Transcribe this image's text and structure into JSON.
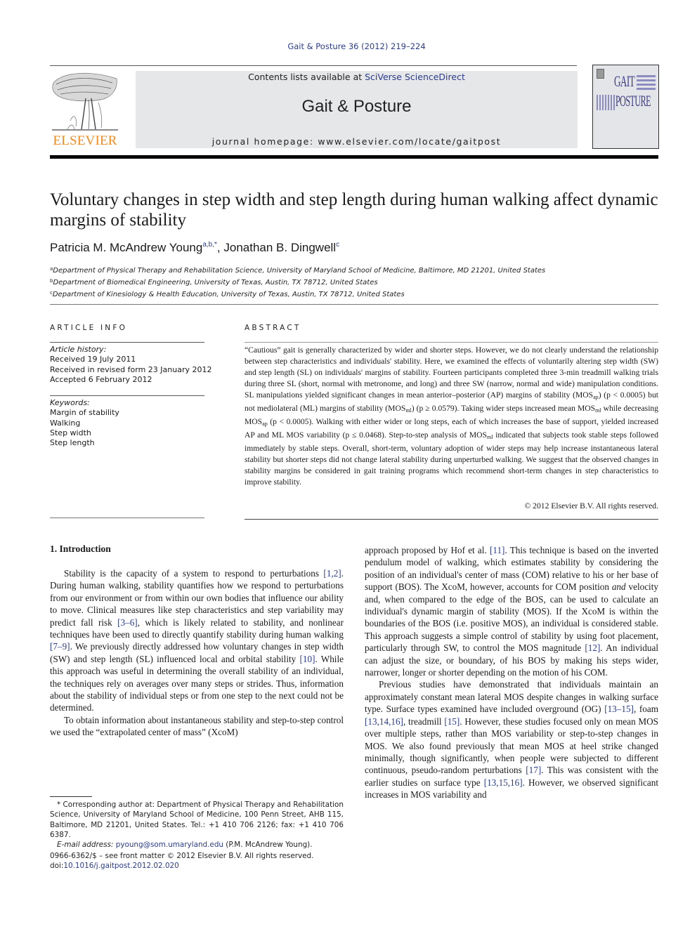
{
  "masthead": {
    "citation": "Gait & Posture 36 (2012) 219–224",
    "contents_prefix": "Contents lists available at ",
    "contents_link": "SciVerse ScienceDirect",
    "journal_title": "Gait & Posture",
    "homepage_prefix": "journal homepage: ",
    "homepage_url": "www.elsevier.com/locate/gaitpost",
    "publisher_logo_text": "ELSEVIER",
    "cover_word_top": "GAIT",
    "cover_word_bottom": "POSTURE",
    "colors": {
      "link": "#2c3c8c",
      "elsevier_orange": "#f08a1c",
      "band_gray": "#e6e7e9"
    }
  },
  "article": {
    "title": "Voluntary changes in step width and step length during human walking affect dynamic margins of stability",
    "authors": [
      {
        "name": "Patricia M. McAndrew Young",
        "sup": "a,b,*"
      },
      {
        "name": "Jonathan B. Dingwell",
        "sup": "c"
      }
    ],
    "author_separator": ", ",
    "affiliations": [
      {
        "key": "a",
        "text": "Department of Physical Therapy and Rehabilitation Science, University of Maryland School of Medicine, Baltimore, MD 21201, United States"
      },
      {
        "key": "b",
        "text": "Department of Biomedical Engineering, University of Texas, Austin, TX 78712, United States"
      },
      {
        "key": "c",
        "text": "Department of Kinesiology & Health Education, University of Texas, Austin, TX 78712, United States"
      }
    ]
  },
  "article_info": {
    "heading": "ARTICLE INFO",
    "history_label": "Article history:",
    "history": [
      "Received 19 July 2011",
      "Received in revised form 23 January 2012",
      "Accepted 6 February 2012"
    ],
    "keywords_label": "Keywords:",
    "keywords": [
      "Margin of stability",
      "Walking",
      "Step width",
      "Step length"
    ]
  },
  "abstract": {
    "heading": "ABSTRACT",
    "parts": {
      "p1": "“Cautious” gait is generally characterized by wider and shorter steps. However, we do not clearly understand the relationship between step characteristics and individuals' stability. Here, we examined the effects of voluntarily altering step width (SW) and step length (SL) on individuals' margins of stability. Fourteen participants completed three 3-min treadmill walking trials during three SL (short, normal with metronome, and long) and three SW (narrow, normal and wide) manipulation conditions. SL manipulations yielded significant changes in mean anterior–posterior (AP) margins of stability (MOS",
      "sub_ap": "ap",
      "p2": ") (p < 0.0005) but not mediolateral (ML) margins of stability (MOS",
      "sub_ml": "ml",
      "p3": ") (p ≥ 0.0579). Taking wider steps increased mean MOS",
      "p4": " while decreasing MOS",
      "p5": " (p < 0.0005). Walking with either wider or long steps, each of which increases the base of support, yielded increased AP and ML MOS variability (p ≤ 0.0468). Step-to-step analysis of MOS",
      "p6": " indicated that subjects took stable steps followed immediately by stable steps. Overall, short-term, voluntary adoption of wider steps may help increase instantaneous lateral stability but shorter steps did not change lateral stability during unperturbed walking. We suggest that the observed changes in stability margins be considered in gait training programs which recommend short-term changes in step characteristics to improve stability."
    },
    "copyright": "© 2012 Elsevier B.V. All rights reserved."
  },
  "body": {
    "section_title": "1.  Introduction",
    "left": {
      "p1_a": "Stability is the capacity of a system to respond to perturbations ",
      "ref_1_2": "[1,2]",
      "p1_b": ". During human walking, stability quantifies how we respond to perturbations from our environment or from within our own bodies that influence our ability to move. Clinical measures like step characteristics and step variability may predict fall risk ",
      "ref_3_6": "[3–6]",
      "p1_c": ", which is likely related to stability, and nonlinear techniques have been used to directly quantify stability during human walking ",
      "ref_7_9": "[7–9]",
      "p1_d": ". We previously directly addressed how voluntary changes in step width (SW) and step length (SL) influenced local and orbital stability ",
      "ref_10": "[10]",
      "p1_e": ". While this approach was useful in determining the overall stability of an individual, the techniques rely on averages over many steps or strides. Thus, information about the stability of individual steps or from one step to the next could not be determined.",
      "p2": "To obtain information about instantaneous stability and step-to-step control we used the “extrapolated center of mass” (XcoM)"
    },
    "right": {
      "p1_a": "approach proposed by Hof et al. ",
      "ref_11": "[11]",
      "p1_b": ". This technique is based on the inverted pendulum model of walking, which estimates stability by considering the position of an individual's center of mass (COM) relative to his or her base of support (BOS). The XcoM, however, accounts for COM position ",
      "p1_and": "and",
      "p1_c": " velocity and, when compared to the edge of the BOS, can be used to calculate an individual's dynamic margin of stability (MOS). If the XcoM is within the boundaries of the BOS (i.e. positive MOS), an individual is considered stable. This approach suggests a simple control of stability by using foot placement, particularly through SW, to control the MOS magnitude ",
      "ref_12": "[12]",
      "p1_d": ". An individual can adjust the size, or boundary, of his BOS by making his steps wider, narrower, longer or shorter depending on the motion of his COM.",
      "p2_a": "Previous studies have demonstrated that individuals maintain an approximately constant mean lateral MOS despite changes in walking surface type. Surface types examined have included overground (OG) ",
      "ref_13_15": "[13–15]",
      "p2_b": ", foam ",
      "ref_13_14_16": "[13,14,16]",
      "p2_c": ", treadmill ",
      "ref_15": "[15]",
      "p2_d": ". However, these studies focused only on mean MOS over multiple steps, rather than MOS variability or step-to-step changes in MOS. We also found previously that mean MOS at heel strike changed minimally, though significantly, when people were subjected to different continuous, pseudo-random perturbations ",
      "ref_17": "[17]",
      "p2_e": ". This was consistent with the earlier studies on surface type ",
      "ref_13_15_16": "[13,15,16]",
      "p2_f": ". However, we observed significant increases in MOS variability and"
    }
  },
  "footnote": {
    "corresponding": "* Corresponding author at: Department of Physical Therapy and Rehabilitation Science, University of Maryland School of Medicine, 100 Penn Street, AHB 115, Baltimore, MD 21201, United States. Tel.: +1 410 706 2126; fax: +1 410 706 6387.",
    "email_label": "E-mail address: ",
    "email": "pyoung@som.umaryland.edu",
    "email_suffix": " (P.M. McAndrew Young).",
    "issn": "0966-6362/$ – see front matter © 2012 Elsevier B.V. All rights reserved.",
    "doi_prefix": "doi:",
    "doi": "10.1016/j.gaitpost.2012.02.020"
  }
}
